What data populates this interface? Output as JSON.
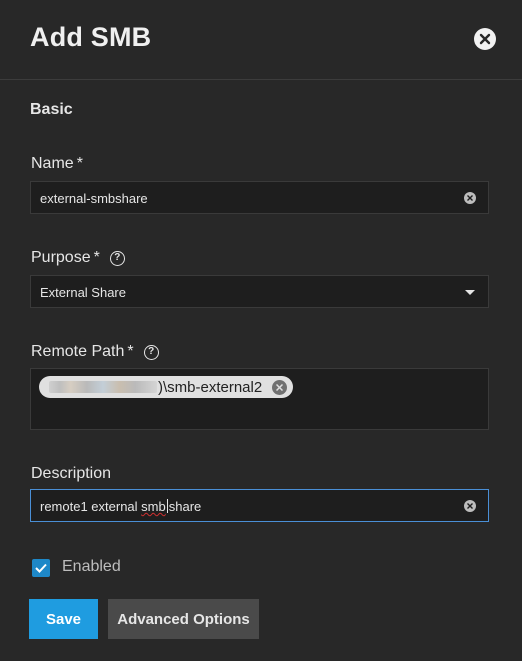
{
  "dialog": {
    "title": "Add SMB"
  },
  "section": {
    "basic": "Basic"
  },
  "name": {
    "label": "Name",
    "required": "*",
    "value": "external-smbshare"
  },
  "purpose": {
    "label": "Purpose",
    "required": "*",
    "value": "External Share"
  },
  "remote_path": {
    "label": "Remote Path",
    "required": "*",
    "chip_text": ")\\smb-external2"
  },
  "description": {
    "label": "Description",
    "value_before": "remote1 external ",
    "value_misspelled": "smb",
    "value_after": "share"
  },
  "enabled": {
    "label": "Enabled",
    "checked": true
  },
  "buttons": {
    "save": "Save",
    "advanced": "Advanced Options"
  },
  "colors": {
    "accent": "#1f9ce0",
    "checkbox": "#1e88c8",
    "background": "#282828"
  }
}
